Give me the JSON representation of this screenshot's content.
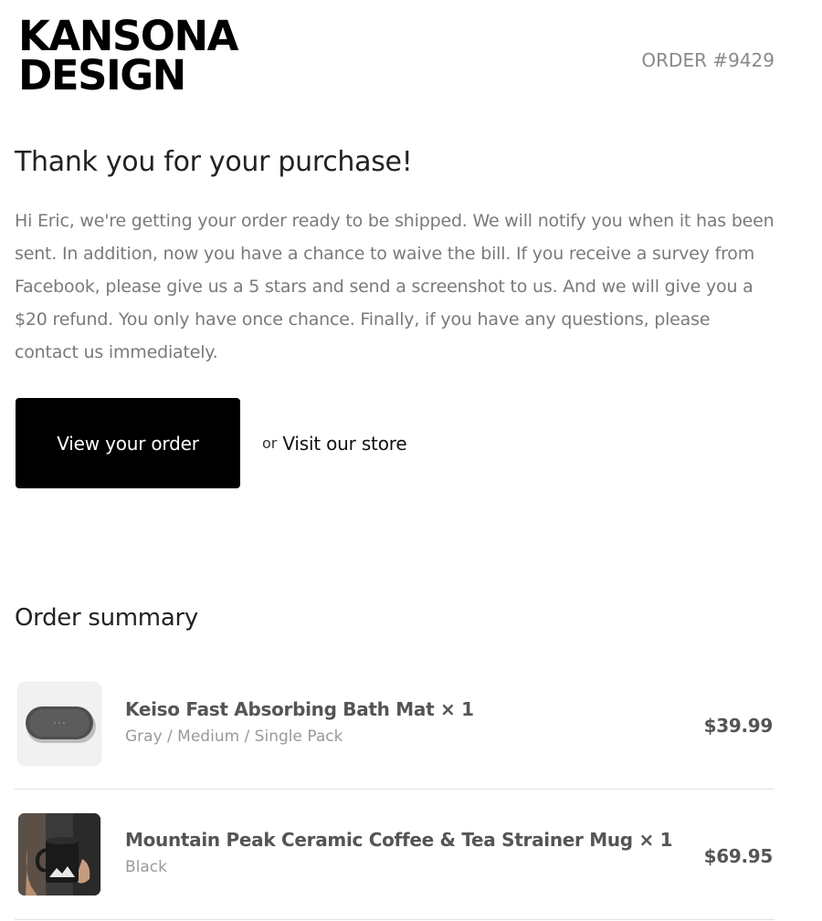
{
  "header": {
    "logo_line1": "KANSONA",
    "logo_line2": "DESIGN",
    "order_number": "ORDER #9429"
  },
  "main": {
    "title": "Thank you for your purchase!",
    "message": "Hi Eric, we're getting your order ready to be shipped. We will notify you when it has been sent. In addition, now you have a chance to waive the bill. If you receive a survey from Facebook, please give us a 5 stars and send a screenshot to us. And we will give you a $20 refund. You only have once chance. Finally, if you have any questions, please contact us immediately.",
    "view_order_label": "View your order",
    "or_label": "or",
    "store_link_label": "Visit our store"
  },
  "summary": {
    "title": "Order summary",
    "items": [
      {
        "name": "Keiso Fast Absorbing Bath Mat × 1",
        "variant": "Gray / Medium / Single Pack",
        "price": "$39.99",
        "image_icon": "bath-mat-icon"
      },
      {
        "name": "Mountain Peak Ceramic Coffee & Tea Strainer Mug × 1",
        "variant": "Black",
        "price": "$69.95",
        "image_icon": "mug-icon"
      }
    ]
  },
  "colors": {
    "button_bg": "#000000",
    "button_text": "#ffffff",
    "body_text": "#7a7a7a",
    "divider": "#e2e2e2"
  }
}
